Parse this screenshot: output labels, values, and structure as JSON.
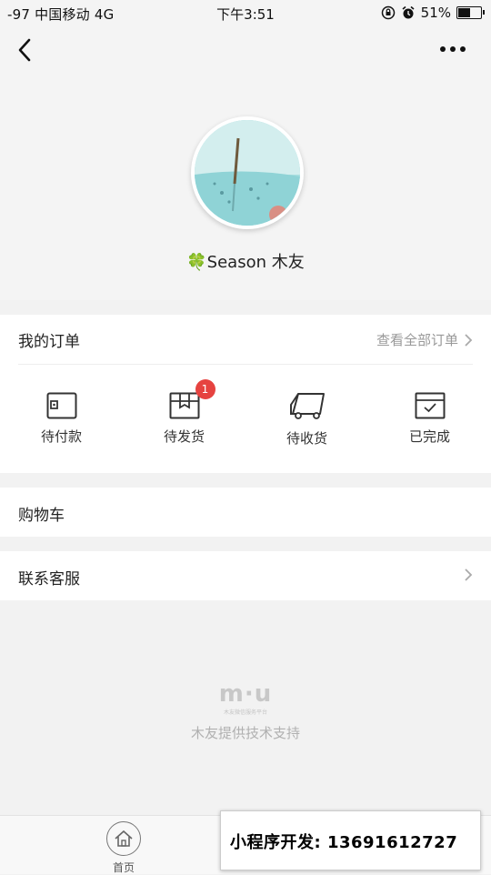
{
  "status_bar": {
    "left": "-97 中国移动   4G",
    "time": "下午3:51",
    "battery": "51%"
  },
  "nav": {
    "back_icon": "chevron-left-icon",
    "more_icon": "more-dots-icon"
  },
  "profile": {
    "clover": "🍀",
    "name": "Season 木友"
  },
  "orders": {
    "title": "我的订单",
    "view_all": "查看全部订单",
    "items": [
      {
        "label": "待付款",
        "icon": "wallet-icon"
      },
      {
        "label": "待发货",
        "icon": "box-icon",
        "badge": "1"
      },
      {
        "label": "待收货",
        "icon": "truck-icon"
      },
      {
        "label": "已完成",
        "icon": "check-box-icon"
      }
    ]
  },
  "menu": {
    "cart": "购物车",
    "service": "联系客服"
  },
  "brand": {
    "logo": "m·u",
    "tagline": "木友微信服务平台",
    "support": "木友提供技术支持"
  },
  "tabbar": {
    "home": "首页"
  },
  "promo": {
    "text": "小程序开发: 13691612727"
  },
  "colors": {
    "badge": "#e64340",
    "page_bg": "#f2f2f2"
  }
}
